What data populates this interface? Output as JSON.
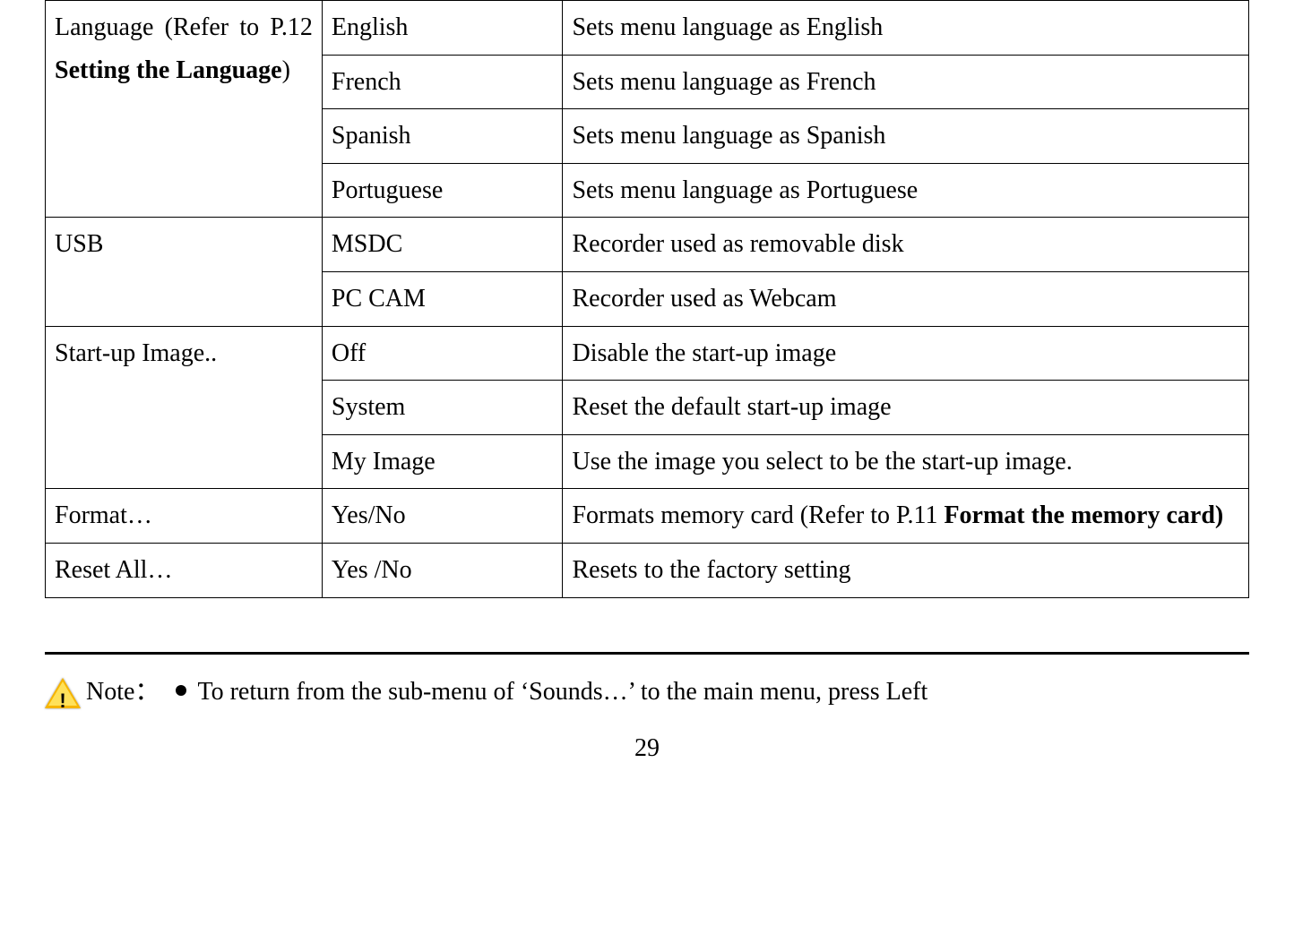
{
  "table": {
    "row_language": {
      "label_part1": "Language (Refer to P.12 ",
      "label_part2_bold": "Setting the Language",
      "label_part3": ")",
      "opts": [
        {
          "name": "English",
          "desc": "Sets menu language as English"
        },
        {
          "name": "French",
          "desc": "Sets menu language as French"
        },
        {
          "name": "Spanish",
          "desc": "Sets menu language as Spanish"
        },
        {
          "name": "Portuguese",
          "desc": "Sets menu language as Portuguese"
        }
      ]
    },
    "row_usb": {
      "label": "USB",
      "opts": [
        {
          "name": "MSDC",
          "desc": "Recorder used as removable disk"
        },
        {
          "name": "PC CAM",
          "desc": "Recorder used as Webcam"
        }
      ]
    },
    "row_startup": {
      "label": "Start-up Image..",
      "opts": [
        {
          "name": "Off",
          "desc": "Disable the start-up image"
        },
        {
          "name": "System",
          "desc": "Reset the default start-up image"
        },
        {
          "name": "My Image",
          "desc": "Use the image you select to be the start-up image."
        }
      ]
    },
    "row_format": {
      "label": "Format…",
      "opt": "Yes/No",
      "desc_part1": "Formats memory card (Refer to P.11 ",
      "desc_part2_bold": "Format the memory card)"
    },
    "row_reset": {
      "label": "Reset All…",
      "opt": "Yes /No",
      "desc": "Resets to the factory setting"
    }
  },
  "note": {
    "label": "Note：",
    "text": "To return from the sub-menu of ‘Sounds…’ to the main menu, press Left"
  },
  "page_number": "29"
}
